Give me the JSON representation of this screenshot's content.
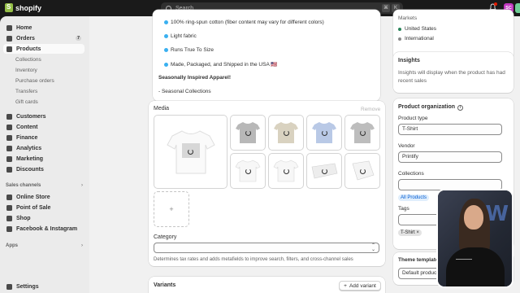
{
  "topbar": {
    "logo_text": "shopify",
    "search_placeholder": "Search",
    "kbd1": "⌘",
    "kbd2": "K",
    "avatar_initials": "SC"
  },
  "sidebar": {
    "items": [
      {
        "label": "Home",
        "icon": "home-icon"
      },
      {
        "label": "Orders",
        "icon": "orders-icon",
        "badge": "7"
      },
      {
        "label": "Products",
        "icon": "tag-icon",
        "active": true
      }
    ],
    "product_sub": [
      "Collections",
      "Inventory",
      "Purchase orders",
      "Transfers",
      "Gift cards"
    ],
    "items2": [
      {
        "label": "Customers",
        "icon": "person-icon"
      },
      {
        "label": "Content",
        "icon": "content-icon"
      },
      {
        "label": "Finance",
        "icon": "bank-icon"
      },
      {
        "label": "Analytics",
        "icon": "chart-icon"
      },
      {
        "label": "Marketing",
        "icon": "target-icon"
      },
      {
        "label": "Discounts",
        "icon": "discount-icon"
      }
    ],
    "sales_channels_label": "Sales channels",
    "channels": [
      {
        "label": "Online Store",
        "icon": "store-icon"
      },
      {
        "label": "Point of Sale",
        "icon": "pos-icon"
      },
      {
        "label": "Shop",
        "icon": "shop-icon"
      },
      {
        "label": "Facebook & Instagram",
        "icon": "meta-icon"
      }
    ],
    "apps_label": "Apps",
    "settings_label": "Settings"
  },
  "description": {
    "lines": [
      "100% ring-spun cotton (fiber content may vary for different colors)",
      "Light fabric",
      "Runs True To Size",
      "Made, Packaged, and Shipped in the USA 🇺🇸"
    ],
    "heading": "Seasonally Inspired Apparel!",
    "signature": "- Seasonal Collections"
  },
  "media": {
    "label": "Media",
    "remove_label": "Remove",
    "add_symbol": "+",
    "thumb_colors": [
      "#ffffff",
      "#b8b8b8",
      "#d9d2c0",
      "#b9c9e6",
      "#bdbdbd",
      "#ffffff",
      "#ffffff",
      "#efefef",
      "#ffffff"
    ]
  },
  "category": {
    "label": "Category",
    "help": "Determines tax rates and adds metafields to improve search, filters, and cross-channel sales"
  },
  "variants": {
    "title": "Variants",
    "add_label": "Add variant"
  },
  "markets": {
    "header_partial": "Markets",
    "items": [
      {
        "label": "United States",
        "color": "#29845a"
      },
      {
        "label": "International",
        "color": "#8a8a8a"
      }
    ]
  },
  "insights": {
    "title": "Insights",
    "text": "Insights will display when the product has had recent sales"
  },
  "organization": {
    "title": "Product organization",
    "type_label": "Product type",
    "type_value": "T-Shirt",
    "vendor_label": "Vendor",
    "vendor_value": "Printify",
    "collections_label": "Collections",
    "collection_tag": "All Products",
    "tags_label": "Tags",
    "tag_value": "T-Shirt",
    "tag_remove": "×"
  },
  "theme": {
    "title": "Theme template",
    "value": "Default product"
  }
}
